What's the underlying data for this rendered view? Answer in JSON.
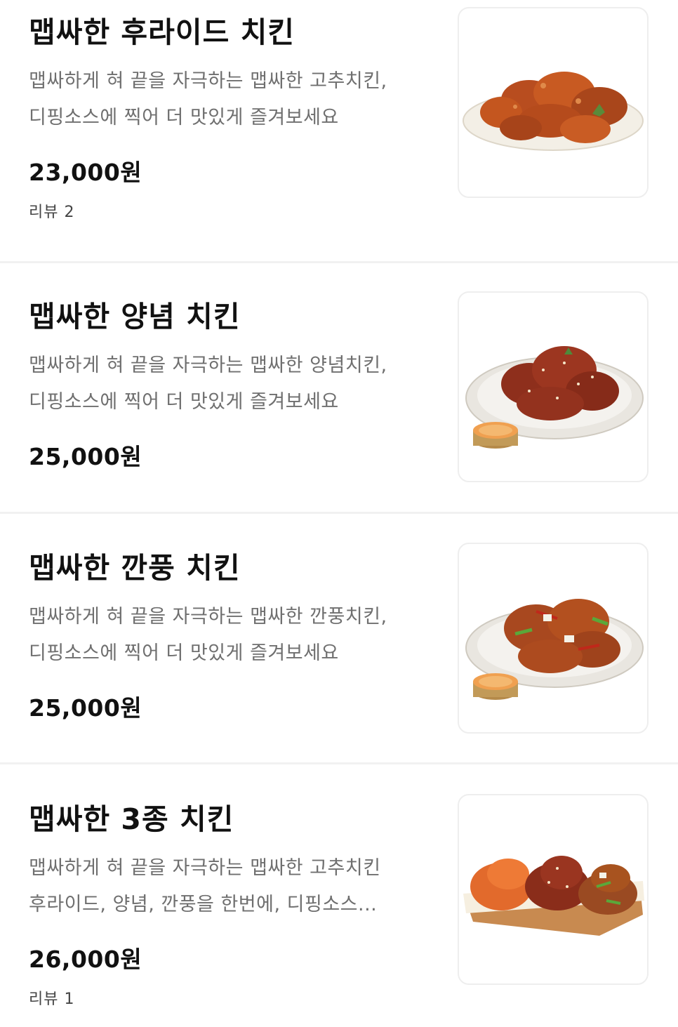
{
  "menu": {
    "items": [
      {
        "name": "맵싸한 후라이드 치킨",
        "desc_line1": "맵싸하게 혀 끝을 자극하는 맵싸한 고추치킨,",
        "desc_line2": "디핑소스에 찍어 더 맛있게 즐겨보세요",
        "price": "23,000원",
        "review": "리뷰 2",
        "image_icon": "fried-chicken-platter-icon"
      },
      {
        "name": "맵싸한 양념 치킨",
        "desc_line1": "맵싸하게 혀 끝을 자극하는 맵싸한 양념치킨,",
        "desc_line2": "디핑소스에 찍어 더 맛있게 즐겨보세요",
        "price": "25,000원",
        "image_icon": "seasoned-chicken-plate-icon"
      },
      {
        "name": "맵싸한 깐풍 치킨",
        "desc_line1": "맵싸하게 혀 끝을 자극하는 맵싸한 깐풍치킨,",
        "desc_line2": "디핑소스에 찍어 더 맛있게 즐겨보세요",
        "price": "25,000원",
        "image_icon": "kkanpung-chicken-plate-icon"
      },
      {
        "name": "맵싸한 3종 치킨",
        "desc_line1": "맵싸하게 혀 끝을 자극하는 맵싸한 고추치킨",
        "desc_line2": "후라이드, 양념, 깐풍을 한번에, 디핑소스...",
        "price": "26,000원",
        "review": "리뷰 1",
        "image_icon": "three-kind-chicken-board-icon"
      }
    ]
  },
  "colors": {
    "text_primary": "#111111",
    "text_secondary": "#6f6f6f",
    "divider": "#f1f1f1",
    "thumb_border": "#eeeeee"
  }
}
